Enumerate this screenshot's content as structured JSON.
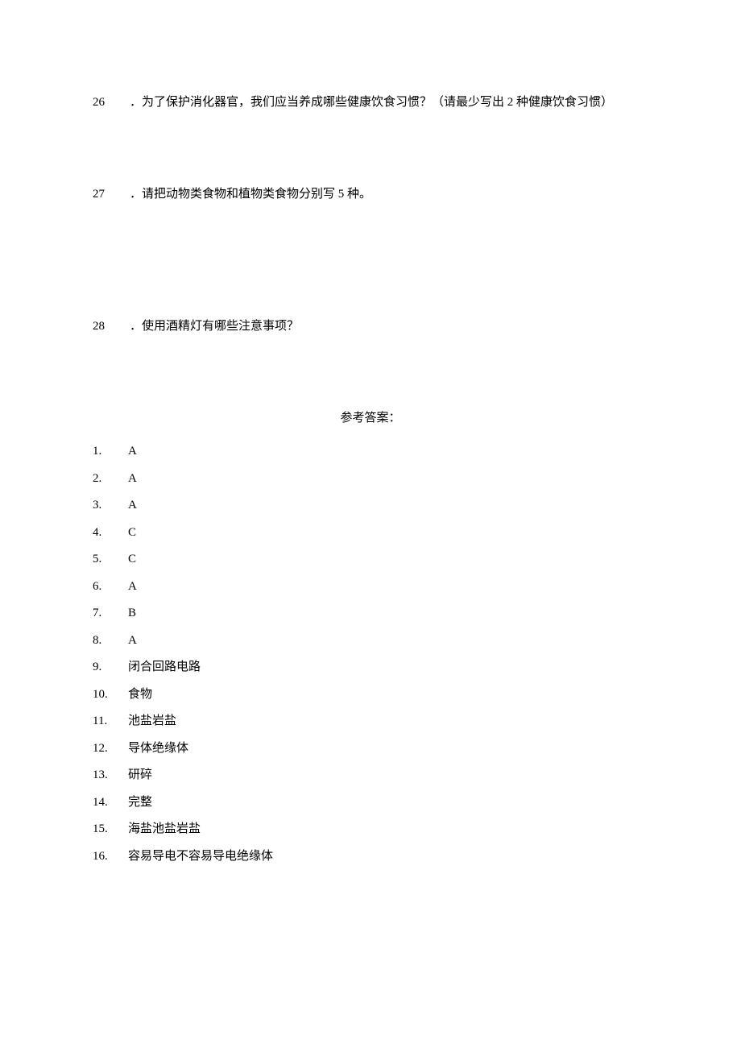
{
  "questions": [
    {
      "num": "26",
      "text": "．为了保护消化器官，我们应当养成哪些健康饮食习惯？（请最少写出 2 种健康饮食习惯）"
    },
    {
      "num": "27",
      "text": "．请把动物类食物和植物类食物分别写 5 种。"
    },
    {
      "num": "28",
      "text": "．使用酒精灯有哪些注意事项？"
    }
  ],
  "answer_title": "参考答案：",
  "answers": [
    {
      "num": "1.",
      "value": "A"
    },
    {
      "num": "2.",
      "value": "A"
    },
    {
      "num": "3.",
      "value": "A"
    },
    {
      "num": "4.",
      "value": "C"
    },
    {
      "num": "5.",
      "value": "C"
    },
    {
      "num": "6.",
      "value": "A"
    },
    {
      "num": "7.",
      "value": "B"
    },
    {
      "num": "8.",
      "value": "A"
    },
    {
      "num": "9.",
      "value": "闭合回路电路"
    },
    {
      "num": "10.",
      "value": "食物"
    },
    {
      "num": "11.",
      "value": "池盐岩盐"
    },
    {
      "num": "12.",
      "value": "导体绝缘体"
    },
    {
      "num": "13.",
      "value": "研碎"
    },
    {
      "num": "14.",
      "value": "完整"
    },
    {
      "num": "15.",
      "value": "海盐池盐岩盐"
    },
    {
      "num": "16.",
      "value": "容易导电不容易导电绝缘体"
    }
  ]
}
